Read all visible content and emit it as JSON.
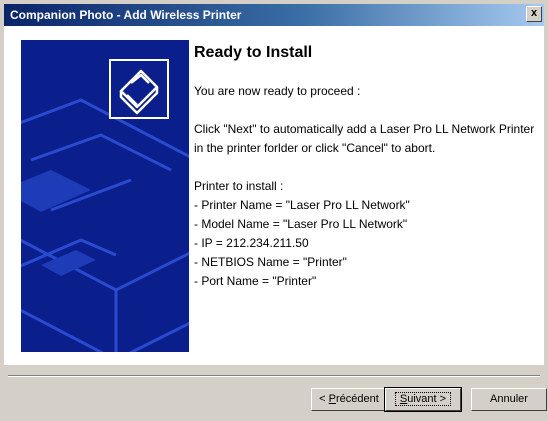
{
  "window": {
    "title": "Companion Photo - Add Wireless Printer",
    "close_label": "x"
  },
  "colors": {
    "title_bar": "#0a246a",
    "side_panel": "#0a1e8c",
    "dialog_bg": "#d4d0c8"
  },
  "side_panel": {
    "icon": "printer-icon"
  },
  "main": {
    "heading": "Ready to Install",
    "intro": "You are now ready to proceed :",
    "instruction": "Click \"Next\" to automatically add a Laser Pro LL Network Printer in the printer forlder or click \"Cancel\" to abort.",
    "printer_header": "Printer to install :",
    "printer_details": [
      "- Printer Name = \"Laser Pro LL Network\"",
      "- Model Name = \"Laser Pro LL Network\"",
      "- IP = 212.234.211.50",
      "- NETBIOS Name = \"Printer\"",
      "- Port Name = \"Printer\""
    ]
  },
  "buttons": {
    "back_prefix": "< ",
    "back_underlined": "P",
    "back_rest": "récédent",
    "next_underlined": "S",
    "next_rest": "uivant >",
    "cancel": "Annuler"
  }
}
